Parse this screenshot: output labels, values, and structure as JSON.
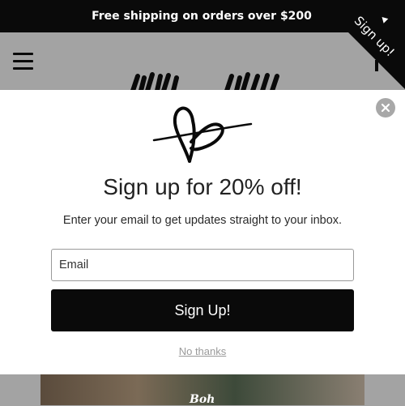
{
  "announcement": {
    "text": "Free shipping on orders over $200"
  },
  "ribbon": {
    "label": "Sign up!",
    "icon": "arrow-up-icon"
  },
  "header": {
    "menu_icon": "hamburger-menu-icon",
    "logo_icon": "brand-logo-icon"
  },
  "modal": {
    "logo_icon": "heart-scribble-icon",
    "title": "Sign up for 20% off!",
    "subtitle": "Enter your email to get updates straight to your inbox.",
    "email_placeholder": "Email",
    "submit_label": "Sign Up!",
    "dismiss_label": "No thanks",
    "close_icon": "close-icon"
  },
  "colors": {
    "bar": "#0a0a0a",
    "overlay": "#a3a3a3",
    "modal_bg": "#ffffff",
    "button": "#0a0a0a",
    "muted_link": "#9a9a9a"
  }
}
